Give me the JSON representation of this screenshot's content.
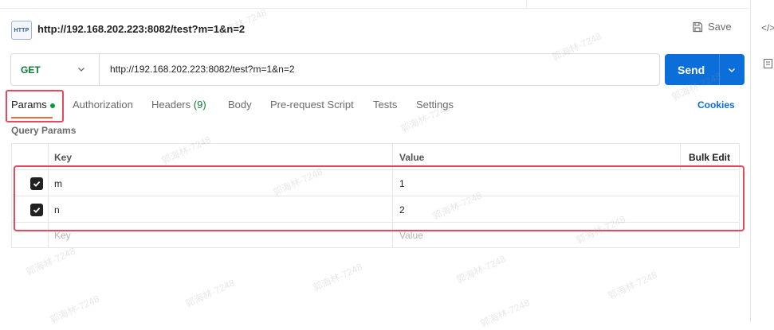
{
  "request": {
    "icon_label": "HTTP",
    "title": "http://192.168.202.223:8082/test?m=1&n=2",
    "save_label": "Save",
    "side_code_label": "</>"
  },
  "url_bar": {
    "method": "GET",
    "url": "http://192.168.202.223:8082/test?m=1&n=2",
    "send_label": "Send"
  },
  "tabs": [
    {
      "label": "Params",
      "active": true,
      "indicator": true
    },
    {
      "label": "Authorization"
    },
    {
      "label": "Headers",
      "count": "(9)"
    },
    {
      "label": "Body"
    },
    {
      "label": "Pre-request Script"
    },
    {
      "label": "Tests"
    },
    {
      "label": "Settings"
    }
  ],
  "cookies_label": "Cookies",
  "query_params": {
    "title": "Query Params",
    "headers": {
      "key": "Key",
      "value": "Value",
      "bulk_edit": "Bulk Edit"
    },
    "rows": [
      {
        "checked": true,
        "key": "m",
        "value": "1"
      },
      {
        "checked": true,
        "key": "n",
        "value": "2"
      }
    ],
    "placeholder": {
      "key": "Key",
      "value": "Value"
    }
  },
  "watermark": "郭海林-7248",
  "colors": {
    "send_button": "#0c6fd9",
    "method_get": "#0a7d32",
    "active_tab_underline": "#f26b3a",
    "annotation_box": "#e8485e",
    "cookies_link": "#0c6fd9"
  },
  "icons": [
    "http-request-icon",
    "save-icon",
    "chevron-down-icon",
    "checkbox-checked-icon",
    "code-icon",
    "document-icon"
  ]
}
